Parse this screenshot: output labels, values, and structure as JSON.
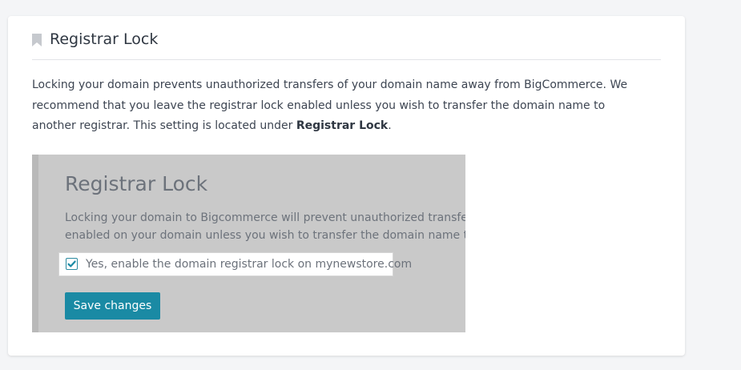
{
  "card": {
    "title": "Registrar Lock",
    "icon": "bookmark-icon",
    "description_part1": "Locking your domain prevents unauthorized transfers of your domain name away from BigCommerce. We recommend that you leave the registrar lock enabled unless you wish to transfer the domain name to another registrar. This setting is located under ",
    "description_bold": "Registrar Lock",
    "description_part2": "."
  },
  "preview": {
    "title": "Registrar Lock",
    "text_line1": "Locking your domain to Bigcommerce will prevent unauthorized transfers of",
    "text_line2": "enabled on your domain unless you wish to transfer the domain name to ano",
    "checkbox_label": "Yes, enable the domain registrar lock on mynewstore.com",
    "checkbox_checked": true,
    "save_label": "Save changes"
  },
  "colors": {
    "accent": "#1a8aa4",
    "preview_bg": "#c9c9c9"
  }
}
